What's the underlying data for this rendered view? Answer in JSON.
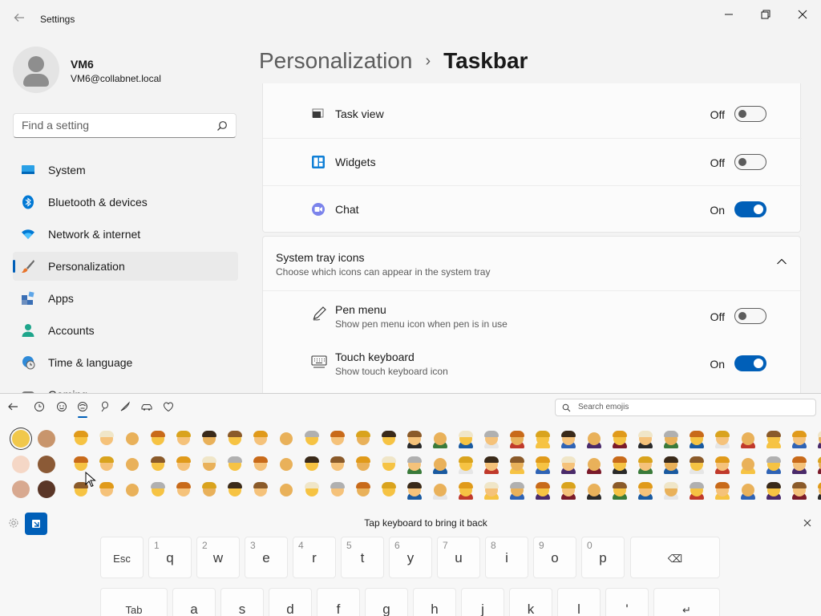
{
  "window": {
    "title": "Settings"
  },
  "user": {
    "name": "VM6",
    "email": "VM6@collabnet.local"
  },
  "search": {
    "placeholder": "Find a setting"
  },
  "sidebar": {
    "items": [
      {
        "label": "System",
        "icon": "system-icon",
        "color": "#0078d4"
      },
      {
        "label": "Bluetooth & devices",
        "icon": "bluetooth-icon",
        "color": "#0078d4"
      },
      {
        "label": "Network & internet",
        "icon": "wifi-icon",
        "color": "#0078d4"
      },
      {
        "label": "Personalization",
        "icon": "brush-icon",
        "color": "#d46a2d",
        "active": true
      },
      {
        "label": "Apps",
        "icon": "apps-icon",
        "color": "#3a6fb5"
      },
      {
        "label": "Accounts",
        "icon": "accounts-icon",
        "color": "#1ea58b"
      },
      {
        "label": "Time & language",
        "icon": "clock-globe-icon",
        "color": "#0078d4"
      },
      {
        "label": "Gaming",
        "icon": "gaming-icon",
        "color": "#5c5c5c"
      }
    ]
  },
  "breadcrumb": {
    "parent": "Personalization",
    "separator": "›",
    "current": "Taskbar"
  },
  "taskbar_items": [
    {
      "label": "Task view",
      "state": "Off",
      "on": false,
      "icon": "task-view-icon"
    },
    {
      "label": "Widgets",
      "state": "Off",
      "on": false,
      "icon": "widgets-icon"
    },
    {
      "label": "Chat",
      "state": "On",
      "on": true,
      "icon": "chat-icon"
    }
  ],
  "system_tray": {
    "title": "System tray icons",
    "subtitle": "Choose which icons can appear in the system tray",
    "items": [
      {
        "label": "Pen menu",
        "subtitle": "Show pen menu icon when pen is in use",
        "state": "Off",
        "on": false,
        "icon": "pen-icon"
      },
      {
        "label": "Touch keyboard",
        "subtitle": "Show touch keyboard icon",
        "state": "On",
        "on": true,
        "icon": "keyboard-icon"
      }
    ]
  },
  "emoji_panel": {
    "search_placeholder": "Search emojis",
    "toolbar_icons": [
      "back-arrow-icon",
      "recent-clock-icon",
      "smiley-icon",
      "people-icon",
      "balloon-icon",
      "pizza-slice-icon",
      "car-icon",
      "heart-icon"
    ],
    "skin_tones": [
      "#f1c84b",
      "#c8956c",
      "#f5d7c6",
      "#8b5a36",
      "#d8a990",
      "#5a3627"
    ],
    "accent": "#005fb8"
  },
  "keyboard": {
    "hint": "Tap keyboard to bring it back",
    "row1": [
      {
        "main": "Esc",
        "fn": true
      },
      {
        "main": "q",
        "num": "1"
      },
      {
        "main": "w",
        "num": "2"
      },
      {
        "main": "e",
        "num": "3"
      },
      {
        "main": "r",
        "num": "4"
      },
      {
        "main": "t",
        "num": "5"
      },
      {
        "main": "y",
        "num": "6"
      },
      {
        "main": "u",
        "num": "7"
      },
      {
        "main": "i",
        "num": "8"
      },
      {
        "main": "o",
        "num": "9"
      },
      {
        "main": "p",
        "num": "0"
      },
      {
        "main": "⌫",
        "fn": true
      }
    ],
    "row2": [
      {
        "main": "Tab",
        "fn": true
      },
      {
        "main": "a"
      },
      {
        "main": "s"
      },
      {
        "main": "d"
      },
      {
        "main": "f"
      },
      {
        "main": "g"
      },
      {
        "main": "h"
      },
      {
        "main": "j"
      },
      {
        "main": "k"
      },
      {
        "main": "l"
      },
      {
        "main": "'"
      },
      {
        "main": "↵",
        "fn": true
      }
    ]
  }
}
